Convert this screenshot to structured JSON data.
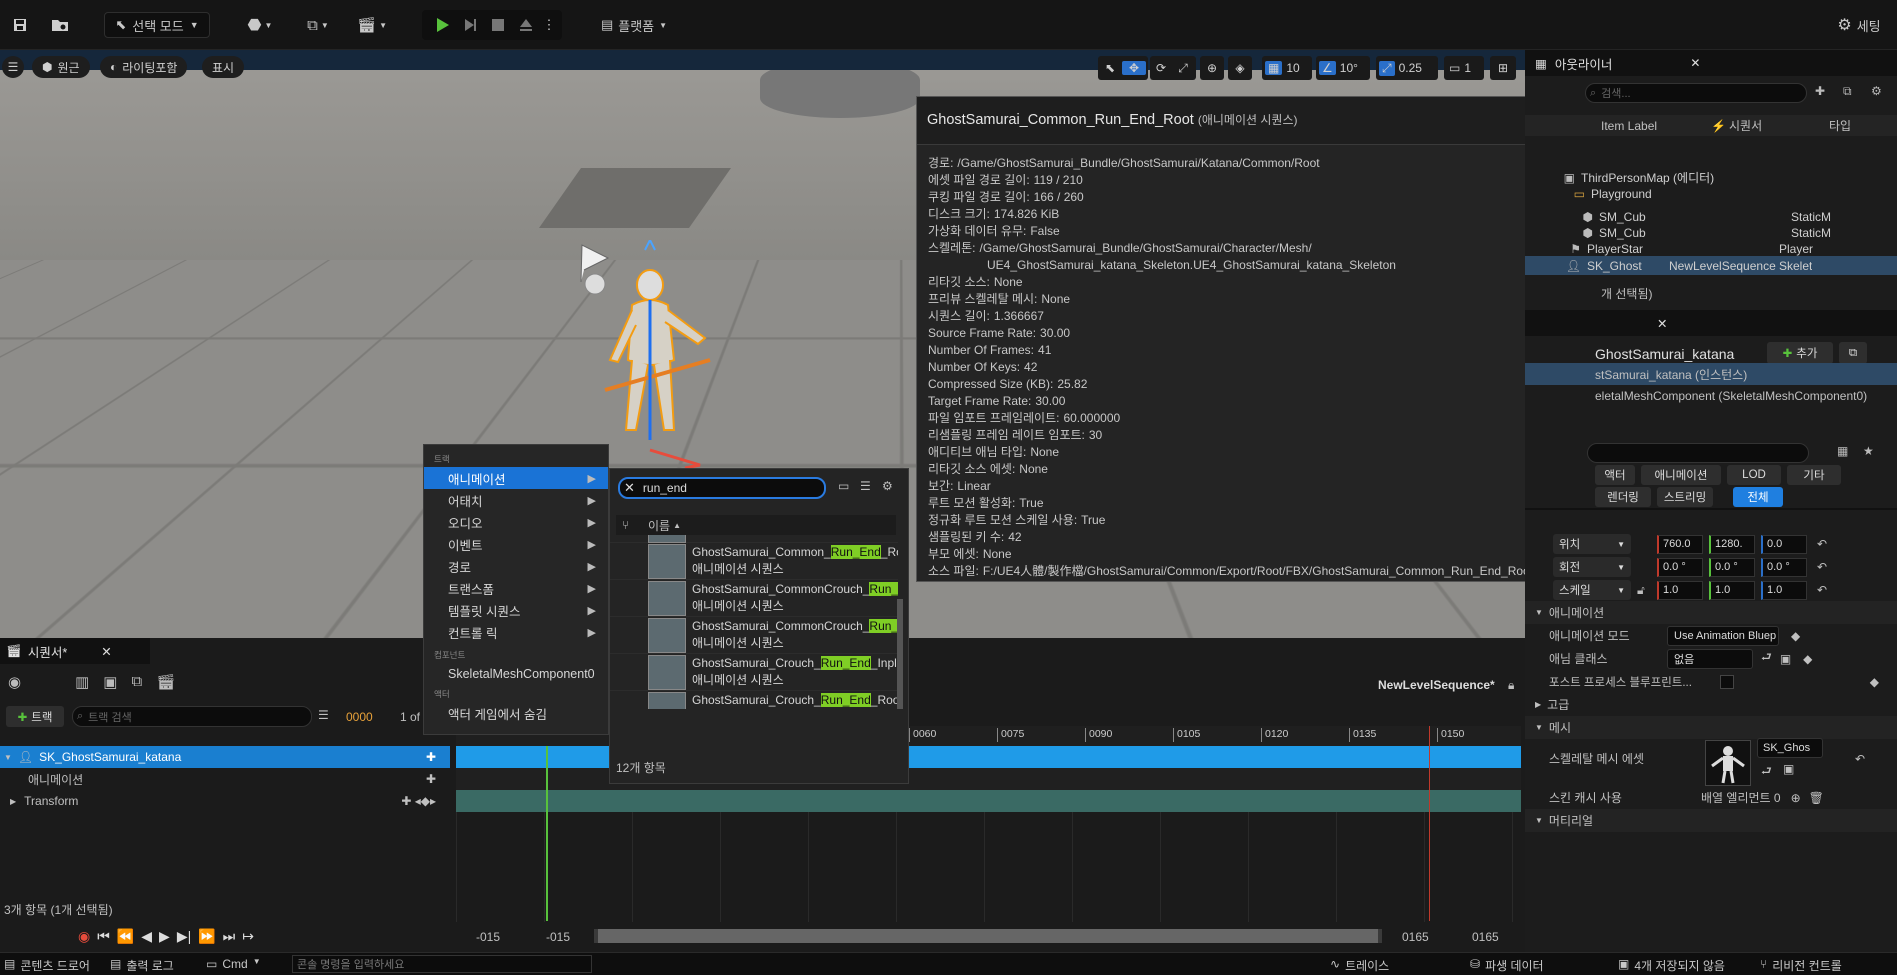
{
  "toolbar": {
    "mode_label": "선택 모드",
    "platform_label": "플랫폼",
    "settings_label": "세팅"
  },
  "viewport": {
    "perspective_label": "원근",
    "lighting_label": "라이팅포함",
    "show_label": "표시",
    "grid_value": "10",
    "angle_value": "10°",
    "scale_value": "0.25",
    "camera_speed": "1"
  },
  "tooltip": {
    "title": "GhostSamurai_Common_Run_End_Root",
    "type": "(애니메이션 시퀀스)",
    "lines": [
      {
        "k": "경로:",
        "v": "/Game/GhostSamurai_Bundle/GhostSamurai/Katana/Common/Root"
      },
      {
        "k": "에셋 파일 경로 길이:",
        "v": "119 / 210"
      },
      {
        "k": "쿠킹 파일 경로 길이:",
        "v": "166 / 260"
      },
      {
        "k": "디스크 크기:",
        "v": "174.826 KiB"
      },
      {
        "k": "가상화 데이터 유무:",
        "v": "False"
      },
      {
        "k": "스켈레톤:",
        "v": "/Game/GhostSamurai_Bundle/GhostSamurai/Character/Mesh/"
      },
      {
        "k": "",
        "v": "UE4_GhostSamurai_katana_Skeleton.UE4_GhostSamurai_katana_Skeleton"
      },
      {
        "k": "리타깃 소스:",
        "v": "None"
      },
      {
        "k": "프리뷰 스켈레탈 메시:",
        "v": "None"
      },
      {
        "k": "시퀀스 길이:",
        "v": "1.366667"
      },
      {
        "k": "Source Frame Rate:",
        "v": "30.00"
      },
      {
        "k": "Number Of Frames:",
        "v": "41"
      },
      {
        "k": "Number Of Keys:",
        "v": "42"
      },
      {
        "k": "Compressed Size (KB):",
        "v": "25.82"
      },
      {
        "k": "Target Frame Rate:",
        "v": "30.00"
      },
      {
        "k": "파일 임포트 프레임레이트:",
        "v": "60.000000"
      },
      {
        "k": "리샘플링 프레임 레이트 임포트:",
        "v": "30"
      },
      {
        "k": "애디티브 애님 타입:",
        "v": "None"
      },
      {
        "k": "리타깃 소스 에셋:",
        "v": "None"
      },
      {
        "k": "보간:",
        "v": "Linear"
      },
      {
        "k": "루트 모션 활성화:",
        "v": "True"
      },
      {
        "k": "정규화 루트 모션 스케일 사용:",
        "v": "True"
      },
      {
        "k": "샘플링된 키 수:",
        "v": "42"
      },
      {
        "k": "부모 에셋:",
        "v": "None"
      },
      {
        "k": "소스 파일:",
        "v": "F:/UE4人體/製作檔/GhostSamurai/Common/Export/Root/FBX/GhostSamurai_Common_Run_End_Root.FBX"
      }
    ]
  },
  "menu": {
    "sec_track": "트랙",
    "items": [
      "애니메이션",
      "어태치",
      "오디오",
      "이벤트",
      "경로",
      "트랜스폼",
      "템플릿 시퀀스",
      "컨트롤 릭"
    ],
    "sec_component": "컴포넌트",
    "component_item": "SkeletalMeshComponent0",
    "sec_actor": "액터",
    "actor_item": "액터 게임에서 숨김"
  },
  "picker": {
    "search_value": "run_end",
    "column_name": "이름",
    "count_label": "12개 항목",
    "rows": [
      {
        "pre": "GhostSamurai_Common_",
        "hl": "Run_End",
        "post": "_Ro",
        "sub": "애니메이션 시퀀스"
      },
      {
        "pre": "GhostSamurai_CommonCrouch_",
        "hl": "Run_",
        "post": "",
        "sub": "애니메이션 시퀀스"
      },
      {
        "pre": "GhostSamurai_CommonCrouch_",
        "hl": "Run_",
        "post": "",
        "sub": "애니메이션 시퀀스"
      },
      {
        "pre": "GhostSamurai_Crouch_",
        "hl": "Run_End",
        "post": "_Inpl",
        "sub": "애니메이션 시퀀스"
      },
      {
        "pre": "GhostSamurai_Crouch_",
        "hl": "Run_End",
        "post": "_Roo",
        "sub": "애니메이션 시퀀스"
      }
    ],
    "partial_row_sub": "애니메이션 시퀀스",
    "thumb_label": "애니메이션 시퀀스"
  },
  "outliner": {
    "title": "아웃라이너",
    "search_placeholder": "검색...",
    "col_label": "Item Label",
    "col_seq": "시퀀서",
    "col_type": "타입",
    "rows": [
      {
        "label": "ThirdPersonMap (에디터)",
        "seq": "",
        "type": ""
      },
      {
        "label": "Playground",
        "seq": "",
        "type": ""
      },
      {
        "label": "SM_Cub",
        "seq": "",
        "type": "StaticM"
      },
      {
        "label": "SM_Cub",
        "seq": "",
        "type": "StaticM"
      },
      {
        "label": "PlayerStar",
        "seq": "",
        "type": "Player"
      },
      {
        "label": "SK_Ghost",
        "seq": "NewLevelSequence",
        "type": "Skelet"
      }
    ],
    "footer": "개 선택됨)"
  },
  "details": {
    "actor_name": "GhostSamurai_katana",
    "add_label": "추가",
    "instance_label": "stSamurai_katana (인스턴스)",
    "component_label": "eletalMeshComponent (SkeletalMeshComponent0)",
    "tabs_row1": [
      "액터",
      "애니메이션",
      "LOD",
      "기타"
    ],
    "tabs_row2": [
      "렌더링",
      "스트리밍",
      "전체"
    ],
    "loc_label": "위치",
    "rot_label": "회전",
    "scale_label": "스케일",
    "loc": [
      "760.0",
      "1280.",
      "0.0"
    ],
    "rot": [
      "0.0 °",
      "0.0 °",
      "0.0 °"
    ],
    "scl": [
      "1.0",
      "1.0",
      "1.0"
    ],
    "anim_section": "애니메이션",
    "anim_mode_label": "애니메이션 모드",
    "anim_mode_value": "Use Animation Bluep",
    "anim_class_label": "애님 클래스",
    "anim_class_value": "없음",
    "post_process_label": "포스트 프로세스 블루프린트...",
    "advanced_label": "고급",
    "mesh_section": "메시",
    "skel_mesh_label": "스켈레탈 메시 에셋",
    "skel_mesh_value": "SK_Ghos",
    "skin_cache_label": "스킨 캐시 사용",
    "skin_cache_value": "배열 엘리먼트 0",
    "material_section": "머티리얼"
  },
  "sequencer": {
    "tab_label": "시퀀서*",
    "track_button": "트랙",
    "search_placeholder": "트랙 검색",
    "frame_value": "0000",
    "of_label": "1 of",
    "sequence_name": "NewLevelSequence*",
    "tracks": [
      "SK_GhostSamurai_katana",
      "애니메이션",
      "Transform"
    ],
    "ticks": [
      "0060",
      "0075",
      "0090",
      "0105",
      "0120",
      "0135",
      "0150"
    ],
    "status": "3개 항목 (1개 선택됨)",
    "range_start": "-015",
    "range_start2": "-015",
    "range_end": "0165",
    "range_end2": "0165"
  },
  "statusbar": {
    "content_drawer": "콘텐츠 드로어",
    "output_log": "출력 로그",
    "cmd": "Cmd",
    "console_placeholder": "콘솔 명령을 입력하세요",
    "trace": "트레이스",
    "derived_data": "파생 데이터",
    "unsaved": "4개 저장되지 않음",
    "revision": "리비전 컨트롤"
  }
}
